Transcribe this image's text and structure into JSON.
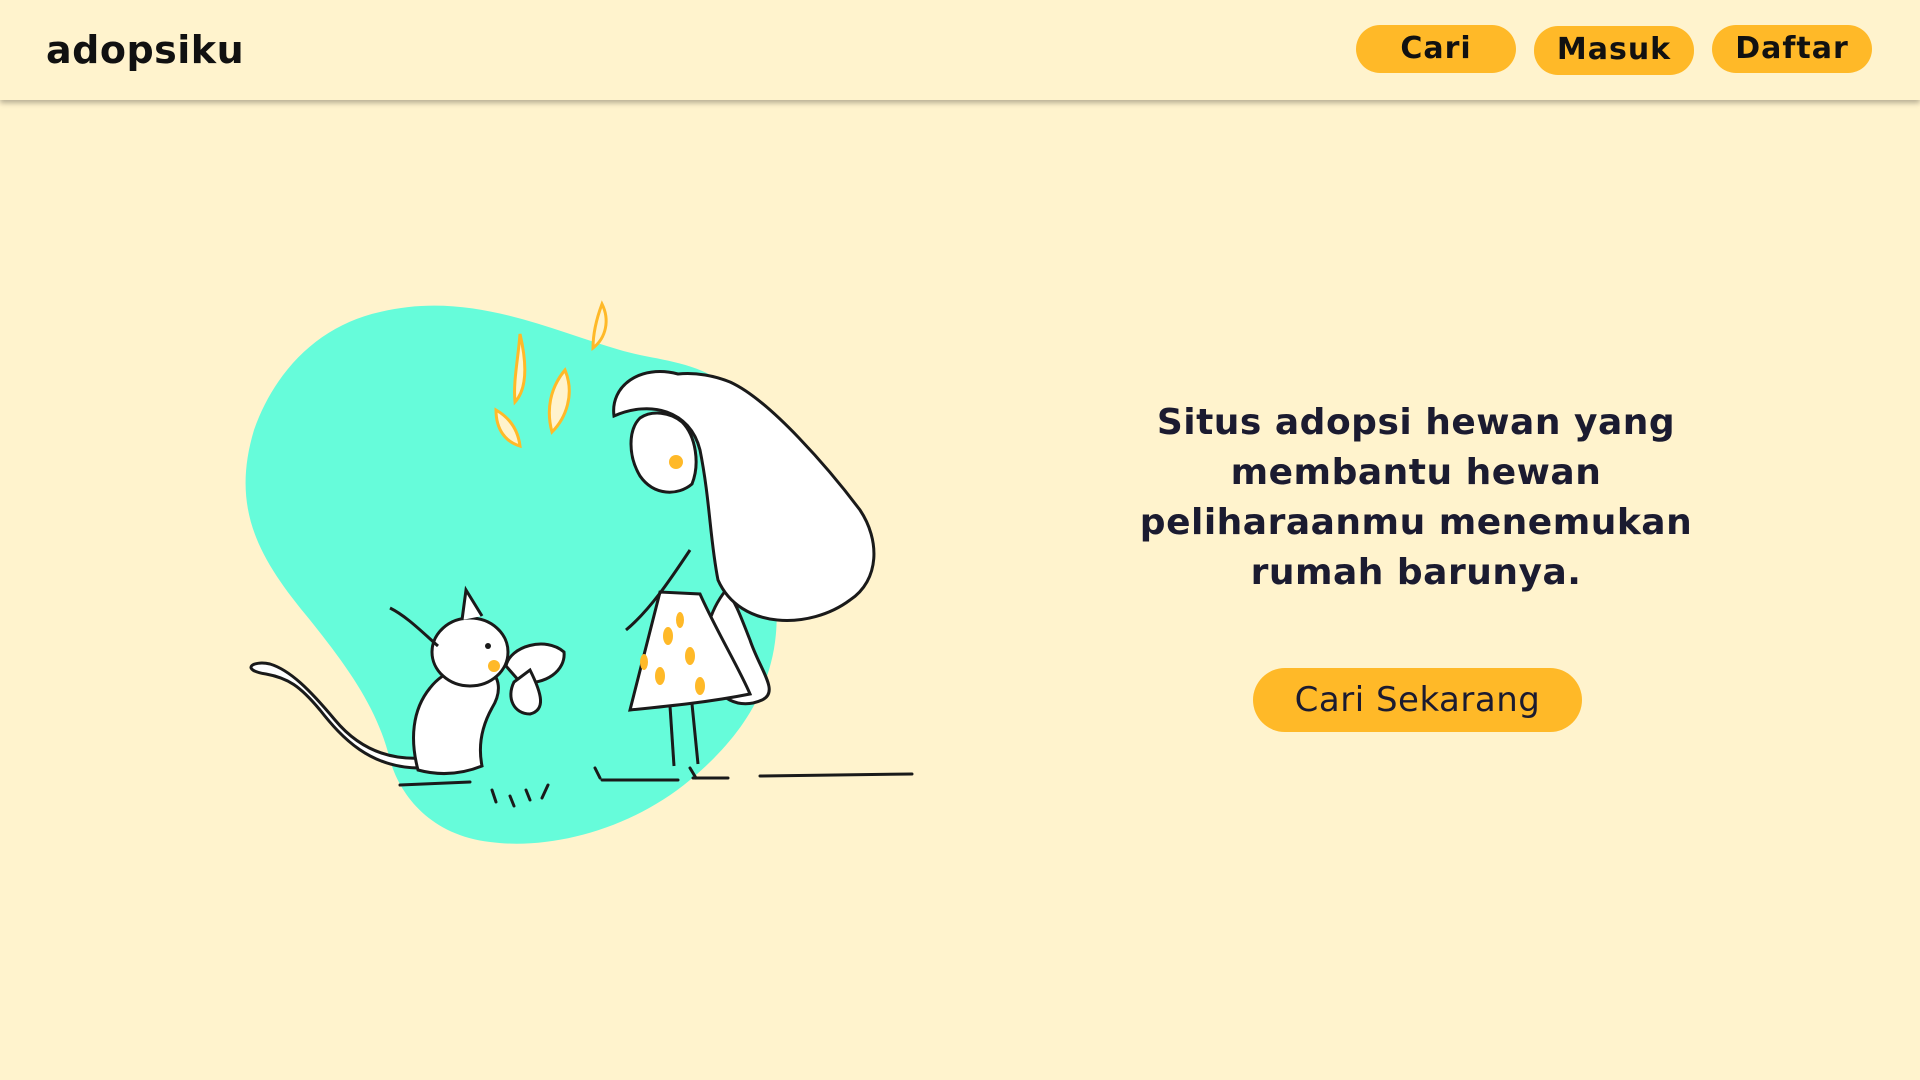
{
  "brand": {
    "logo_text": "adopsiku"
  },
  "nav": {
    "search_label": "Cari",
    "login_label": "Masuk",
    "register_label": "Daftar"
  },
  "hero": {
    "headline": "Situs adopsi hewan yang membantu hewan peliharaanmu menemukan rumah barunya.",
    "cta_label": "Cari Sekarang",
    "illustration_icon": "girl-and-squirrel-illustration"
  },
  "colors": {
    "background": "#FFF3CD",
    "accent": "#FFB928",
    "blob": "#66FCDA",
    "text": "#1B1B30"
  }
}
